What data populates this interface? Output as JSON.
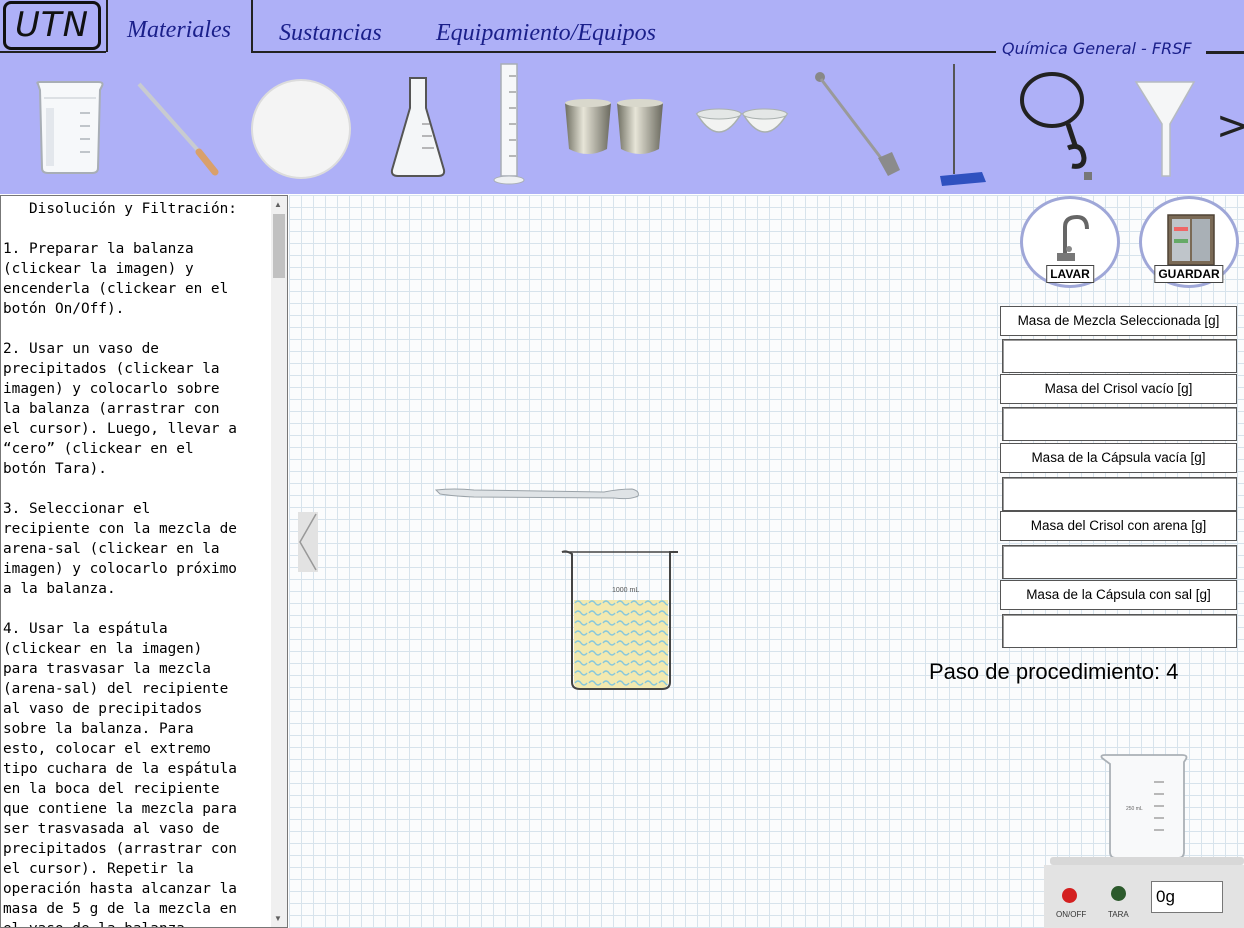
{
  "header": {
    "logo": "UTN",
    "tabs": [
      {
        "label": "Materiales",
        "active": true
      },
      {
        "label": "Sustancias",
        "active": false
      },
      {
        "label": "Equipamiento/Equipos",
        "active": false
      }
    ],
    "course": "Química General - FRSF",
    "next_arrow": ">"
  },
  "shelf_items": [
    "beaker-icon",
    "pipette-icon",
    "filter-paper-icon",
    "erlenmeyer-flask-icon",
    "graduated-cylinder-icon",
    "crucibles-icon",
    "evaporating-dishes-icon",
    "spatula-icon",
    "ring-stand-icon",
    "ring-clamp-icon",
    "funnel-icon"
  ],
  "instructions": {
    "text": "   Disolución y Filtración:\n\n1. Preparar la balanza\n(clickear la imagen) y\nencenderla (clickear en el\nbotón On/Off).\n\n2. Usar un vaso de\nprecipitados (clickear la\nimagen) y colocarlo sobre\nla balanza (arrastrar con\nel cursor). Luego, llevar a\n“cero” (clickear en el\nbotón Tara).\n\n3. Seleccionar el\nrecipiente con la mezcla de\narena-sal (clickear en la\nimagen) y colocarlo próximo\na la balanza.\n\n4. Usar la espátula\n(clickear en la imagen)\npara trasvasar la mezcla\n(arena-sal) del recipiente\nal vaso de precipitados\nsobre la balanza. Para\nesto, colocar el extremo\ntipo cuchara de la espátula\nen la boca del recipiente\nque contiene la mezcla para\nser trasvasada al vaso de\nprecipitados (arrastrar con\nel cursor). Repetir la\noperación hasta alcanzar la\nmasa de 5 g de la mezcla en\nel vaso de la balanza."
  },
  "actions": {
    "lavar": "LAVAR",
    "guardar": "GUARDAR"
  },
  "mass_fields": [
    {
      "label": "Masa de Mezcla Seleccionada [g]",
      "value": ""
    },
    {
      "label": "Masa del Crisol vacío [g]",
      "value": ""
    },
    {
      "label": "Masa de la Cápsula vacía [g]",
      "value": ""
    },
    {
      "label": "Masa del Crisol con arena [g]",
      "value": ""
    },
    {
      "label": "Masa de la Cápsula con sal [g]",
      "value": ""
    }
  ],
  "procedure": {
    "text": "Paso de procedimiento: 4"
  },
  "workspace": {
    "mixture_beaker_label": "1000 mL",
    "balance_beaker_label": "250 mL"
  },
  "balance": {
    "display": "0g",
    "onoff_label": "ON/OFF",
    "tara_label": "TARA",
    "onoff_color": "#d42020",
    "tara_color": "#2c5a2c"
  }
}
